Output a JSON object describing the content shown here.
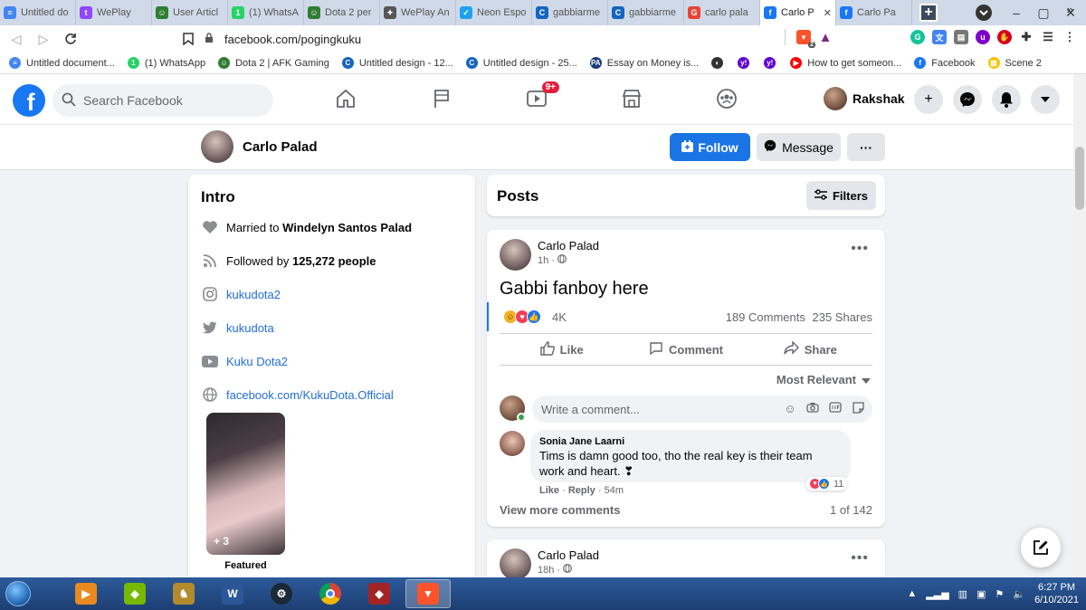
{
  "browser": {
    "tabs": [
      {
        "label": "Untitled do",
        "color": "#4285f4",
        "glyph": "≡"
      },
      {
        "label": "WePlay",
        "color": "#9146ff",
        "glyph": "t"
      },
      {
        "label": "User Articl",
        "color": "#2e7d32",
        "glyph": "☺"
      },
      {
        "label": "(1) WhatsA",
        "color": "#25d366",
        "glyph": "1"
      },
      {
        "label": "Dota 2 per",
        "color": "#2e7d32",
        "glyph": "☺"
      },
      {
        "label": "WePlay An",
        "color": "#555555",
        "glyph": "✦"
      },
      {
        "label": "Neon Espo",
        "color": "#1da1f2",
        "glyph": "✓"
      },
      {
        "label": "gabbiarme",
        "color": "#1565c0",
        "glyph": "C"
      },
      {
        "label": "gabbiarme",
        "color": "#1565c0",
        "glyph": "C"
      },
      {
        "label": "carlo pala",
        "color": "#ea4335",
        "glyph": "G"
      },
      {
        "label": "Carlo P",
        "color": "#1877f2",
        "glyph": "f",
        "active": true
      },
      {
        "label": "Carlo Pa",
        "color": "#1877f2",
        "glyph": "f"
      }
    ],
    "new_tab": "+",
    "url": "facebook.com/pogingkuku",
    "brave_badge": "2",
    "bookmarks": [
      {
        "label": "Untitled document...",
        "color": "#4285f4",
        "glyph": "≡"
      },
      {
        "label": "(1) WhatsApp",
        "color": "#25d366",
        "glyph": "1"
      },
      {
        "label": "Dota 2 | AFK Gaming",
        "color": "#2e7d32",
        "glyph": "☺"
      },
      {
        "label": "Untitled design - 12...",
        "color": "#1565c0",
        "glyph": "C"
      },
      {
        "label": "Untitled design - 25...",
        "color": "#1565c0",
        "glyph": "C"
      },
      {
        "label": "Essay on Money is...",
        "color": "#1a3d7c",
        "glyph": "PA"
      },
      {
        "label": "",
        "color": "#333333",
        "glyph": "◐"
      },
      {
        "label": "",
        "color": "#6001d2",
        "glyph": "y!"
      },
      {
        "label": "",
        "color": "#6001d2",
        "glyph": "y!"
      },
      {
        "label": "How to get someon...",
        "color": "#ff0000",
        "glyph": "▶"
      },
      {
        "label": "Facebook",
        "color": "#1877f2",
        "glyph": "f"
      },
      {
        "label": "Scene 2",
        "color": "#f5c400",
        "glyph": "▧"
      }
    ],
    "bookmarks_more": "»"
  },
  "fb": {
    "search_placeholder": "Search Facebook",
    "watch_badge": "9+",
    "user_name": "Rakshak",
    "brand_color": "#1877f2"
  },
  "profile": {
    "name": "Carlo Palad",
    "follow_label": "Follow",
    "message_label": "Message",
    "more_label": "···"
  },
  "intro": {
    "title": "Intro",
    "married_prefix": "Married to ",
    "married_name": "Windelyn Santos Palad",
    "followed_prefix": "Followed by ",
    "followed_count": "125,272 people",
    "instagram": "kukudota2",
    "twitter": "kukudota",
    "youtube": "Kuku Dota2",
    "website": "facebook.com/KukuDota.Official",
    "featured_extra": "+ 3",
    "featured_label": "Featured"
  },
  "posts": {
    "title": "Posts",
    "filters_label": "Filters",
    "items": [
      {
        "author": "Carlo Palad",
        "time": "1h",
        "text": "Gabbi fanboy here",
        "reactions": "4K",
        "comments": "189 Comments",
        "shares": "235 Shares",
        "like_label": "Like",
        "comment_label": "Comment",
        "share_label": "Share",
        "sort_label": "Most Relevant",
        "comment_placeholder": "Write a comment...",
        "top_comment": {
          "author": "Sonia Jane Laarni",
          "text_line1": "Tims is damn good too, tho the real key is their team",
          "text_line2": "work and heart. ❣",
          "react_count": "11",
          "like": "Like",
          "reply": "Reply",
          "time": "54m"
        },
        "view_more": "View more comments",
        "comment_count": "1 of 142"
      },
      {
        "author": "Carlo Palad",
        "time": "18h"
      }
    ]
  },
  "taskbar": {
    "time": "6:27 PM",
    "date": "6/10/2021"
  }
}
